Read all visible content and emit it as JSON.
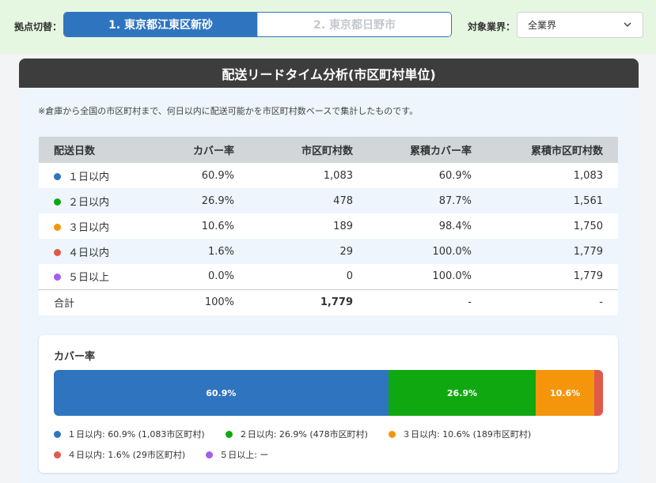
{
  "header": {
    "site_label": "拠点切替：",
    "sites": [
      "1. 東京都江東区新砂",
      "2. 東京都日野市"
    ],
    "industry_label": "対象業界：",
    "industry_selected": "全業界"
  },
  "panel": {
    "title": "配送リードタイム分析(市区町村単位)",
    "note": "※倉庫から全国の市区町村まで、何日以内に配送可能かを市区町村数ベースで集計したものです。"
  },
  "table": {
    "columns": [
      "配送日数",
      "カバー率",
      "市区町村数",
      "累積カバー率",
      "累積市区町村数"
    ],
    "rows": [
      {
        "label": "１日以内",
        "cover": "60.9%",
        "count": "1,083",
        "cum_cover": "60.9%",
        "cum_count": "1,083",
        "color": "#2f74bf"
      },
      {
        "label": "２日以内",
        "cover": "26.9%",
        "count": "478",
        "cum_cover": "87.7%",
        "cum_count": "1,561",
        "color": "#10a810"
      },
      {
        "label": "３日以内",
        "cover": "10.6%",
        "count": "189",
        "cum_cover": "98.4%",
        "cum_count": "1,750",
        "color": "#f5950b"
      },
      {
        "label": "４日以内",
        "cover": "1.6%",
        "count": "29",
        "cum_cover": "100.0%",
        "cum_count": "1,779",
        "color": "#e05a4a"
      },
      {
        "label": "５日以上",
        "cover": "0.0%",
        "count": "0",
        "cum_cover": "100.0%",
        "cum_count": "1,779",
        "color": "#a55cf0"
      }
    ],
    "total": {
      "label": "合計",
      "cover": "100%",
      "count": "1,779",
      "cum_cover": "-",
      "cum_count": "-"
    }
  },
  "coverage": {
    "title": "カバー率",
    "segments": [
      {
        "pct": 60.9,
        "label": "60.9%",
        "color": "#2f74bf"
      },
      {
        "pct": 26.9,
        "label": "26.9%",
        "color": "#10a810"
      },
      {
        "pct": 10.6,
        "label": "10.6%",
        "color": "#f5950b"
      },
      {
        "pct": 1.6,
        "label": "",
        "color": "#e05a4a"
      }
    ],
    "legend": [
      {
        "text": "１日以内: 60.9% (1,083市区町村)",
        "color": "#2f74bf"
      },
      {
        "text": "２日以内: 26.9% (478市区町村)",
        "color": "#10a810"
      },
      {
        "text": "３日以内: 10.6% (189市区町村)",
        "color": "#f5950b"
      },
      {
        "text": "４日以内: 1.6% (29市区町村)",
        "color": "#e05a4a"
      },
      {
        "text": "５日以上: ー",
        "color": "#a55cf0"
      }
    ]
  }
}
